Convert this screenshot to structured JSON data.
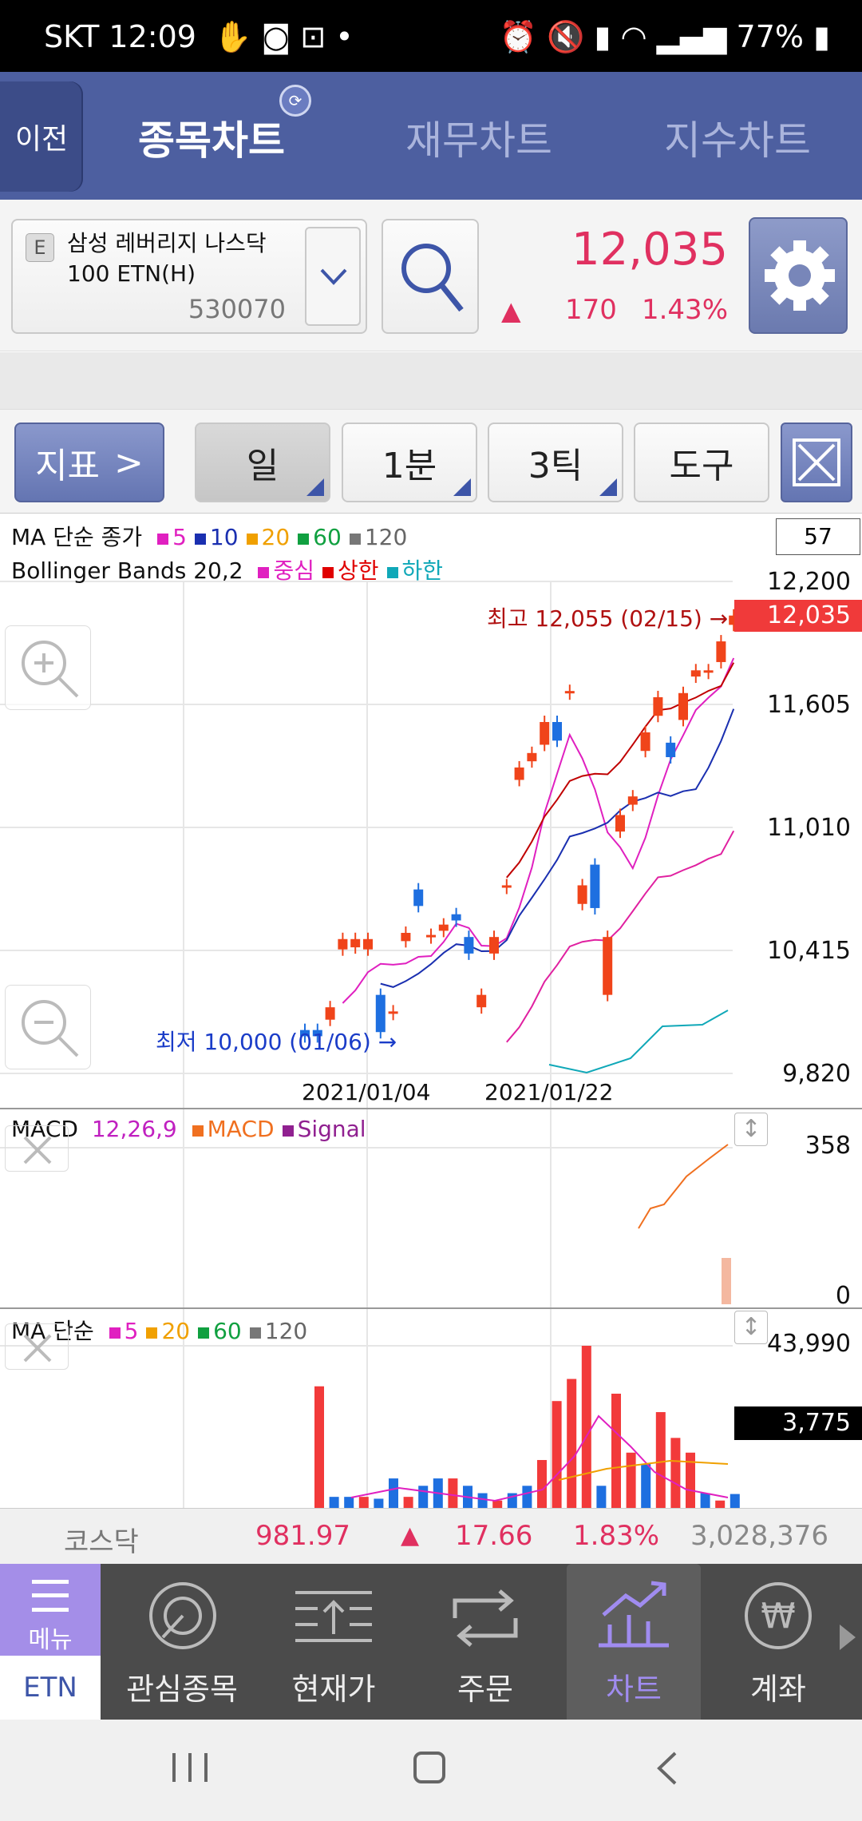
{
  "status_bar": {
    "carrier": "SKT",
    "time": "12:09",
    "battery": "77%"
  },
  "header": {
    "back_label": "이전",
    "tabs": [
      "종목차트",
      "재무차트",
      "지수차트"
    ],
    "active_tab": "종목차트"
  },
  "stock": {
    "badge": "E",
    "name": "삼성 레버리지 나스닥 100 ETN(H)",
    "code": "530070",
    "price": "12,035",
    "change": "170",
    "change_pct": "1.43%"
  },
  "toolbar": {
    "indicator_label": "지표",
    "period": "일",
    "minute": "1분",
    "tick": "3틱",
    "tools": "도구"
  },
  "chart": {
    "count_box": "57",
    "ma_legend": {
      "prefix": "MA 단순 종가",
      "items": [
        {
          "label": "5",
          "color": "#e020c0"
        },
        {
          "label": "10",
          "color": "#1a2fb0"
        },
        {
          "label": "20",
          "color": "#f0a000"
        },
        {
          "label": "60",
          "color": "#10a040"
        },
        {
          "label": "120",
          "color": "#777777"
        }
      ]
    },
    "bb_legend": {
      "prefix": "Bollinger Bands 20,2",
      "items": [
        {
          "label": "중심",
          "color": "#e020c0"
        },
        {
          "label": "상한",
          "color": "#e00000"
        },
        {
          "label": "하한",
          "color": "#10a8b8"
        }
      ]
    },
    "y_labels": [
      "12,200",
      "11,605",
      "11,010",
      "10,415",
      "9,820"
    ],
    "current_price_tag": "12,035",
    "high_annotation": "최고 12,055 (02/15) →",
    "low_annotation": "최저 10,000 (01/06) →",
    "x_labels": [
      "2021/01/04",
      "2021/01/22"
    ],
    "macd_legend": {
      "title": "MACD",
      "params": "12,26,9",
      "items": [
        {
          "label": "MACD",
          "color": "#f07020"
        },
        {
          "label": "Signal",
          "color": "#902090"
        }
      ]
    },
    "macd_y": [
      "358",
      "0"
    ],
    "vol_legend": {
      "title": "MA 단순",
      "items": [
        {
          "label": "5",
          "color": "#e020c0"
        },
        {
          "label": "20",
          "color": "#f0a000"
        },
        {
          "label": "60",
          "color": "#10a040"
        },
        {
          "label": "120",
          "color": "#777777"
        }
      ]
    },
    "vol_y": "43,990",
    "vol_tag": "3,775"
  },
  "market": {
    "name": "코스닥",
    "value": "981.97",
    "change": "17.66",
    "pct": "1.83%",
    "volume": "3,028,376"
  },
  "bottom_nav": {
    "menu": "메뉴",
    "etn": "ETN",
    "items": [
      "관심종목",
      "현재가",
      "주문",
      "차트",
      "계좌"
    ],
    "active": "차트"
  },
  "colors": {
    "up": "#e03060",
    "header": "#4d5fa0",
    "active_tab": "#a08cf0"
  },
  "chart_data": {
    "type": "candlestick",
    "ylim": [
      9820,
      12200
    ],
    "candles": [
      {
        "o": 10000,
        "c": 10030,
        "up": false
      },
      {
        "o": 10030,
        "c": 10000,
        "up": false
      },
      {
        "o": 10080,
        "c": 10140,
        "up": true
      },
      {
        "o": 10420,
        "c": 10470,
        "up": true
      },
      {
        "o": 10430,
        "c": 10470,
        "up": true
      },
      {
        "o": 10420,
        "c": 10470,
        "up": true
      },
      {
        "o": 10020,
        "c": 10200,
        "up": false
      },
      {
        "o": 10120,
        "c": 10120,
        "up": true
      },
      {
        "o": 10460,
        "c": 10500,
        "up": true
      },
      {
        "o": 10710,
        "c": 10630,
        "up": false
      },
      {
        "o": 10490,
        "c": 10490,
        "up": true
      },
      {
        "o": 10510,
        "c": 10540,
        "up": true
      },
      {
        "o": 10590,
        "c": 10560,
        "up": false
      },
      {
        "o": 10480,
        "c": 10400,
        "up": false
      },
      {
        "o": 10140,
        "c": 10200,
        "up": true
      },
      {
        "o": 10400,
        "c": 10480,
        "up": true
      },
      {
        "o": 10730,
        "c": 10730,
        "up": true
      },
      {
        "o": 11240,
        "c": 11300,
        "up": true
      },
      {
        "o": 11330,
        "c": 11370,
        "up": true
      },
      {
        "o": 11410,
        "c": 11520,
        "up": true
      },
      {
        "o": 11520,
        "c": 11430,
        "up": false
      },
      {
        "o": 11670,
        "c": 11670,
        "up": true
      },
      {
        "o": 10640,
        "c": 10730,
        "up": true
      },
      {
        "o": 10830,
        "c": 10620,
        "up": false
      },
      {
        "o": 10200,
        "c": 10480,
        "up": true
      },
      {
        "o": 10990,
        "c": 11070,
        "up": true
      },
      {
        "o": 11120,
        "c": 11160,
        "up": true
      },
      {
        "o": 11380,
        "c": 11470,
        "up": true
      },
      {
        "o": 11550,
        "c": 11640,
        "up": true
      },
      {
        "o": 11420,
        "c": 11350,
        "up": false
      },
      {
        "o": 11530,
        "c": 11660,
        "up": true
      },
      {
        "o": 11740,
        "c": 11770,
        "up": true
      },
      {
        "o": 11770,
        "c": 11770,
        "up": true
      },
      {
        "o": 11810,
        "c": 11910,
        "up": true
      },
      {
        "o": 11990,
        "c": 12035,
        "up": true
      }
    ],
    "volume": [
      33000,
      3000,
      3000,
      3000,
      2500,
      8000,
      3000,
      6000,
      8000,
      8000,
      6000,
      4000,
      2000,
      4000,
      6000,
      13000,
      29000,
      35000,
      44000,
      6000,
      31000,
      15000,
      12000,
      26000,
      19000,
      15000,
      4000,
      2000,
      3775
    ]
  }
}
